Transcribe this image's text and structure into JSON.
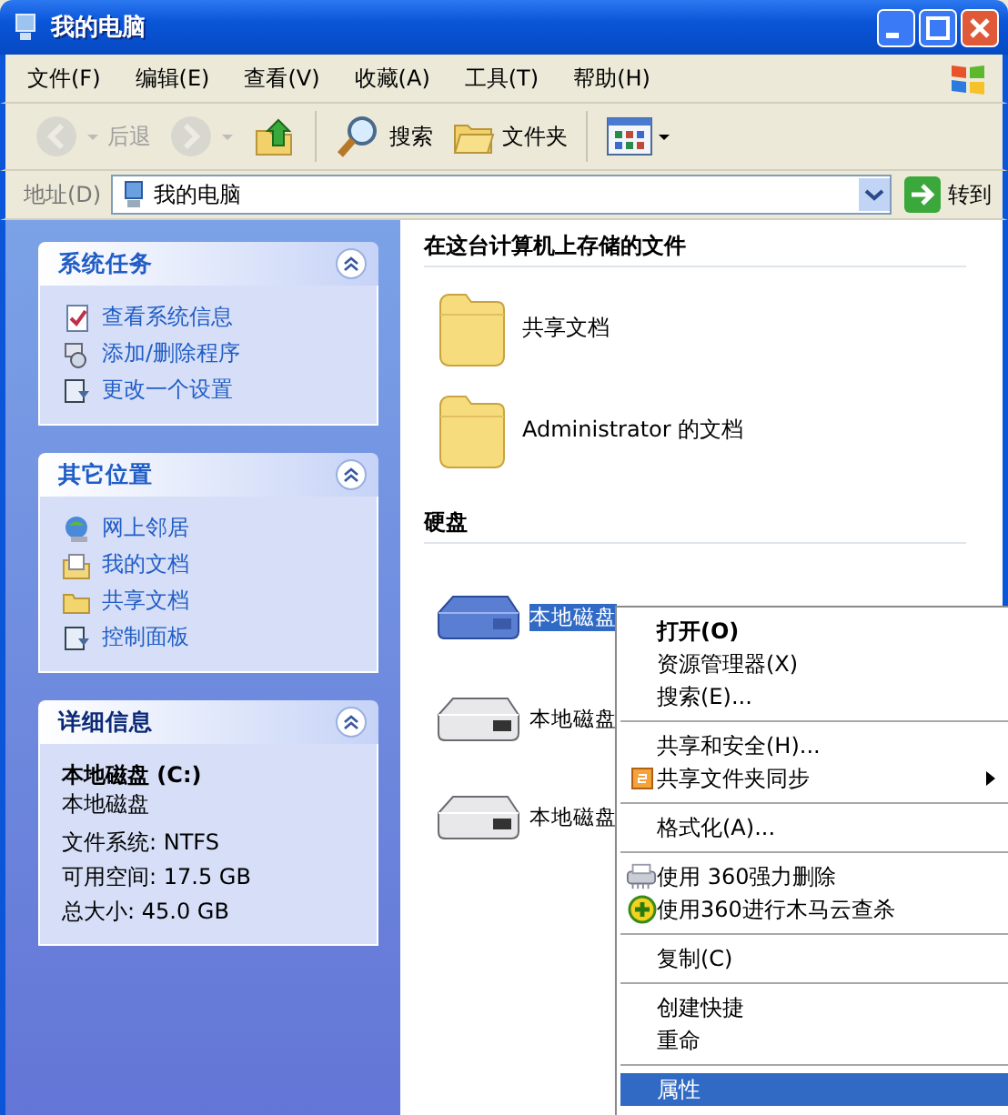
{
  "window": {
    "title": "我的电脑"
  },
  "menu_bar": [
    "文件(F)",
    "编辑(E)",
    "查看(V)",
    "收藏(A)",
    "工具(T)",
    "帮助(H)"
  ],
  "toolbar": [
    {
      "kind": "back",
      "label": "后退",
      "disabled": true
    },
    {
      "kind": "forward",
      "disabled": true
    },
    {
      "kind": "up",
      "disabled": false
    },
    {
      "kind": "search",
      "label": "搜索",
      "disabled": false
    },
    {
      "kind": "folders",
      "label": "文件夹",
      "disabled": false
    },
    {
      "kind": "views",
      "disabled": false
    }
  ],
  "address_bar": {
    "label": "地址(D)",
    "value": "我的电脑",
    "go_button": "转到"
  },
  "sidebar": {
    "panels": [
      {
        "title": "系统任务",
        "expanded": true,
        "items": [
          {
            "kind": "sysinfo",
            "label": "查看系统信息"
          },
          {
            "kind": "programs",
            "label": "添加/删除程序"
          },
          {
            "kind": "settings",
            "label": "更改一个设置"
          }
        ]
      },
      {
        "title": "其它位置",
        "expanded": true,
        "items": [
          {
            "kind": "network",
            "label": "网上邻居"
          },
          {
            "kind": "documents",
            "label": "我的文档"
          },
          {
            "kind": "folder",
            "label": "共享文档"
          },
          {
            "kind": "settings",
            "label": "控制面板"
          }
        ]
      },
      {
        "title": "详细信息",
        "expanded": true,
        "details": {
          "name": "本地磁盘 (C:)",
          "type": "本地磁盘",
          "lines": [
            "文件系统: NTFS",
            "可用空间: 17.5 GB",
            "总大小: 45.0 GB"
          ]
        }
      }
    ]
  },
  "content": {
    "sections": [
      {
        "heading": "在这台计算机上存储的文件",
        "items": [
          {
            "kind": "folder",
            "label": "共享文档",
            "selected": false
          },
          {
            "kind": "folder",
            "label": "Administrator 的文档",
            "selected": false
          }
        ]
      },
      {
        "heading": "硬盘",
        "items": [
          {
            "kind": "drive",
            "label": "本地磁盘",
            "selected": true
          },
          {
            "kind": "drive",
            "label": "本地磁盘",
            "selected": false
          },
          {
            "kind": "drive",
            "label": "本地磁盘",
            "selected": false
          }
        ]
      }
    ]
  },
  "context_menu": {
    "groups": [
      {
        "items": [
          {
            "kind": "plain",
            "label": "打开(O)",
            "default": true,
            "submenu": false,
            "selected": false
          },
          {
            "kind": "plain",
            "label": "资源管理器(X)",
            "default": false,
            "submenu": false,
            "selected": false
          },
          {
            "kind": "plain",
            "label": "搜索(E)...",
            "default": false,
            "submenu": false,
            "selected": false
          }
        ]
      },
      {
        "items": [
          {
            "kind": "plain",
            "label": "共享和安全(H)...",
            "default": false,
            "submenu": false,
            "selected": false
          },
          {
            "kind": "sync",
            "label": "共享文件夹同步",
            "default": false,
            "submenu": true,
            "selected": false
          }
        ]
      },
      {
        "items": [
          {
            "kind": "plain",
            "label": "格式化(A)...",
            "default": false,
            "submenu": false,
            "selected": false
          }
        ]
      },
      {
        "items": [
          {
            "kind": "shredder",
            "label": "使用 360强力删除",
            "default": false,
            "submenu": false,
            "selected": false
          },
          {
            "kind": "scan",
            "label": "使用360进行木马云查杀",
            "default": false,
            "submenu": false,
            "selected": false
          }
        ]
      },
      {
        "items": [
          {
            "kind": "plain",
            "label": "复制(C)",
            "default": false,
            "submenu": false,
            "selected": false
          }
        ]
      },
      {
        "items": [
          {
            "kind": "plain",
            "label": "创建快捷",
            "default": false,
            "submenu": false,
            "selected": false
          },
          {
            "kind": "plain",
            "label": "重命",
            "default": false,
            "submenu": false,
            "selected": false
          }
        ]
      },
      {
        "items": [
          {
            "kind": "plain",
            "label": "属性",
            "default": false,
            "submenu": false,
            "selected": true
          }
        ]
      }
    ]
  }
}
